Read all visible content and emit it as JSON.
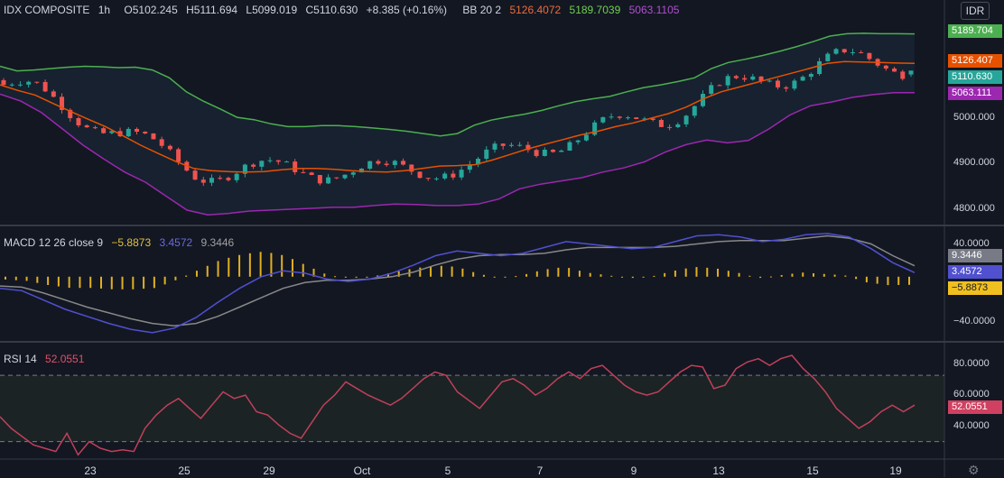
{
  "header": {
    "symbol": "IDX COMPOSITE",
    "interval": "1h",
    "open": "O5102.245",
    "high": "H5111.694",
    "low": "L5099.019",
    "close": "C5110.630",
    "change": "+8.385 (+0.16%)",
    "bb_label": "BB 20 2",
    "bb_upper": "5126.4072",
    "bb_basis": "5189.7039",
    "bb_lower": "5063.1105",
    "currency": "IDR"
  },
  "price_axis": {
    "ticks": [
      "5000.000",
      "4900.000",
      "4800.000"
    ],
    "badge_upper": "5189.704",
    "badge_basis": "5126.407",
    "badge_last": "5110.630",
    "badge_lower": "5063.111"
  },
  "macd": {
    "label": "MACD 12 26 close 9",
    "histogram": "−5.8873",
    "macd": "3.4572",
    "signal": "9.3446",
    "ticks": [
      "40.0000",
      "−40.0000"
    ],
    "badge_signal": "9.3446",
    "badge_macd": "3.4572",
    "badge_hist": "−5.8873"
  },
  "rsi": {
    "label": "RSI 14",
    "value": "52.0551",
    "ticks": [
      "80.0000",
      "60.0000",
      "40.0000"
    ],
    "badge": "52.0551"
  },
  "time_axis": [
    "23",
    "25",
    "29",
    "Oct",
    "5",
    "7",
    "9",
    "13",
    "15",
    "19"
  ],
  "colors": {
    "background": "#131722",
    "up": "#26a69a",
    "down": "#ef5350",
    "bb_upper": "#4caf50",
    "bb_basis": "#e65100",
    "bb_lower": "#9c27b0",
    "macd": "#5050d0",
    "signal": "#888888",
    "histogram": "#e0b020",
    "rsi": "#c0405a"
  },
  "chart_data": {
    "type": "candlestick",
    "series": [
      {
        "name": "BB upper",
        "values": [
          5120,
          5110,
          5112,
          5115,
          5118,
          5120,
          5119,
          5117,
          5118,
          5112,
          5095,
          5065,
          5045,
          5028,
          5010,
          5005,
          4996,
          4990,
          4990,
          4992,
          4992,
          4990,
          4987,
          4984,
          4980,
          4975,
          4970,
          4975,
          4993,
          5004,
          5011,
          5017,
          5025,
          5035,
          5044,
          5050,
          5055,
          5065,
          5074,
          5080,
          5087,
          5095,
          5115,
          5128,
          5135,
          5143,
          5152,
          5162,
          5173,
          5185,
          5190,
          5191,
          5190,
          5190,
          5189.704
        ]
      },
      {
        "name": "BB basis",
        "values": [
          5080,
          5068,
          5058,
          5040,
          5023,
          5006,
          4990,
          4970,
          4950,
          4932,
          4915,
          4900,
          4895,
          4893,
          4892,
          4893,
          4897,
          4900,
          4900,
          4898,
          4895,
          4893,
          4892,
          4895,
          4900,
          4905,
          4906,
          4908,
          4918,
          4930,
          4942,
          4952,
          4962,
          4972,
          4980,
          4990,
          4998,
          5008,
          5018,
          5032,
          5050,
          5065,
          5075,
          5085,
          5095,
          5105,
          5115,
          5126,
          5130,
          5129,
          5128,
          5127,
          5126.4
        ]
      },
      {
        "name": "BB lower",
        "values": [
          5060,
          5045,
          5020,
          4985,
          4950,
          4920,
          4892,
          4870,
          4840,
          4810,
          4800,
          4803,
          4808,
          4810,
          4812,
          4814,
          4816,
          4816,
          4820,
          4823,
          4822,
          4820,
          4820,
          4823,
          4834,
          4856,
          4866,
          4873,
          4880,
          4892,
          4901,
          4914,
          4935,
          4951,
          4961,
          4955,
          4960,
          4985,
          5015,
          5035,
          5043,
          5053,
          5059,
          5063,
          5063.1
        ]
      }
    ],
    "price_range": [
      4777,
      5220
    ],
    "macd_range": [
      -55,
      40
    ],
    "rsi_range": [
      20,
      88
    ],
    "rsi_levels": [
      70,
      30
    ]
  }
}
